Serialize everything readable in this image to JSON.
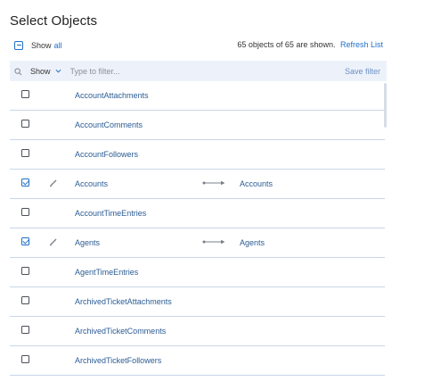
{
  "title": "Select Objects",
  "show_all": {
    "prefix": "Show",
    "link": "all"
  },
  "summary": {
    "text": "65 objects of 65 are shown.",
    "refresh": "Refresh List"
  },
  "filter": {
    "show_label": "Show",
    "placeholder": "Type to filter...",
    "save_label": "Save filter"
  },
  "rows": [
    {
      "name": "AccountAttachments",
      "checked": false,
      "target": ""
    },
    {
      "name": "AccountComments",
      "checked": false,
      "target": ""
    },
    {
      "name": "AccountFollowers",
      "checked": false,
      "target": ""
    },
    {
      "name": "Accounts",
      "checked": true,
      "target": "Accounts"
    },
    {
      "name": "AccountTimeEntries",
      "checked": false,
      "target": ""
    },
    {
      "name": "Agents",
      "checked": true,
      "target": "Agents"
    },
    {
      "name": "AgentTimeEntries",
      "checked": false,
      "target": ""
    },
    {
      "name": "ArchivedTicketAttachments",
      "checked": false,
      "target": ""
    },
    {
      "name": "ArchivedTicketComments",
      "checked": false,
      "target": ""
    },
    {
      "name": "ArchivedTicketFollowers",
      "checked": false,
      "target": ""
    }
  ],
  "colors": {
    "accent": "#1e6fc8",
    "filter_bg": "#edf2fa",
    "row_text": "#2b5c94",
    "divider": "#c9d6e8"
  },
  "icons": [
    "minus-box-icon",
    "search-icon",
    "chevron-down-icon",
    "checkbox-icon",
    "pencil-icon",
    "arrow-right-icon"
  ]
}
